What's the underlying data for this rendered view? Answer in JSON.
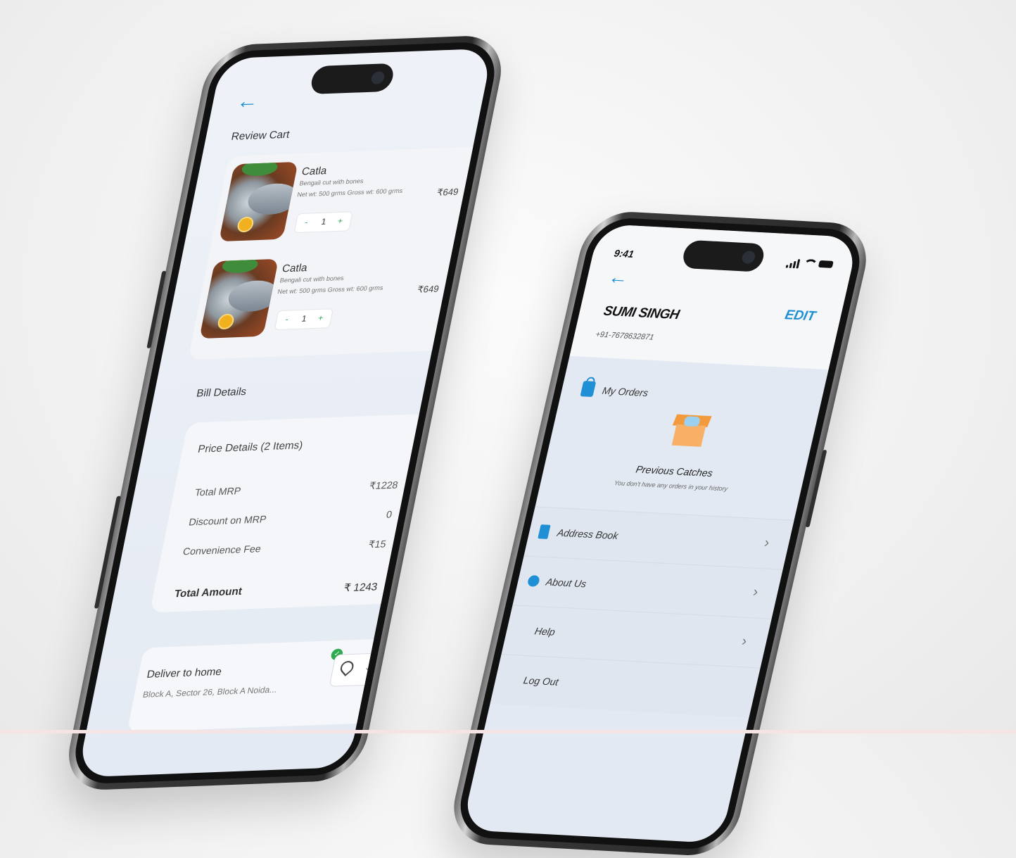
{
  "cart_screen": {
    "title": "Review Cart",
    "items": [
      {
        "name": "Catla",
        "desc": "Bengali cut with bones",
        "meta": "Net wt: 500 grms   Gross wt: 600 grms",
        "price": "₹649",
        "qty": "1",
        "minus": "-",
        "plus": "+"
      },
      {
        "name": "Catla",
        "desc": "Bengali cut with bones",
        "meta": "Net wt: 500 grms   Gross wt: 600 grms",
        "price": "₹649",
        "qty": "1",
        "minus": "-",
        "plus": "+"
      }
    ],
    "bill_section_label": "Bill Details",
    "bill": {
      "title": "Price Details (2 Items)",
      "rows": [
        {
          "label": "Total MRP",
          "value": "₹1228"
        },
        {
          "label": "Discount on MRP",
          "value": "0"
        },
        {
          "label": "Convenience Fee",
          "value": "₹15"
        }
      ],
      "total_label": "Total Amount",
      "total_value": "₹ 1243"
    },
    "delivery": {
      "title": "Deliver to home",
      "address": "Block A, Sector 26, Block A Noida...",
      "check": "✓",
      "chevron": "⌄"
    }
  },
  "profile_screen": {
    "status_time": "9:41",
    "name": "SUMI SINGH",
    "edit": "EDIT",
    "phone": "+91-7678632871",
    "orders_label": "My Orders",
    "previous_title": "Previous Catches",
    "previous_sub": "You don't have any orders in your history",
    "menu": [
      {
        "label": "Address Book",
        "chevron": "›"
      },
      {
        "label": "About Us",
        "chevron": "›"
      },
      {
        "label": "Help",
        "chevron": "›"
      },
      {
        "label": "Log Out",
        "chevron": ""
      }
    ]
  },
  "icons": {
    "back": "←",
    "bag": "shopping-bag-icon",
    "box": "catch-box-icon",
    "book": "address-book-icon",
    "info": "info-icon",
    "location": "location-pin-icon"
  },
  "colors": {
    "accent": "#1f8fd6",
    "green": "#2aa84a",
    "box_orange": "#f39a3d"
  }
}
